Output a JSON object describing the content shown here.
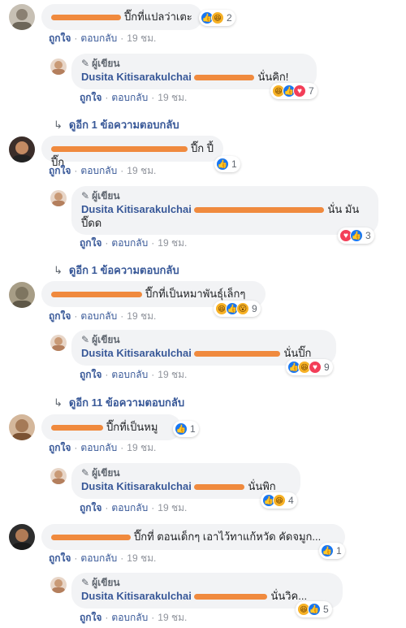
{
  "labels": {
    "like": "ถูกใจ",
    "reply": "ตอบกลับ",
    "author_tag": "ผู้เขียน"
  },
  "colors": {
    "link": "#385898",
    "bubble": "#f2f3f5",
    "redaction": "#f08a3e"
  },
  "author_name": "Dusita Kitisarakulchai",
  "threads": [
    {
      "comment": {
        "text": "ปี๊กที่แปลว่าเตะ",
        "time": "19 ชม.",
        "reaction_count": "2",
        "reactions": [
          "like-icon",
          "haha-icon"
        ]
      },
      "reply": {
        "text": "นั่นคิก!",
        "time": "19 ชม.",
        "reaction_count": "7",
        "reactions": [
          "haha-icon",
          "like-icon",
          "love-icon"
        ]
      },
      "more": null
    },
    {
      "comment": {
        "text": "ปี๊ก ปี้ ปี๊ก",
        "time": "19 ชม.",
        "reaction_count": "1",
        "reactions": [
          "like-icon"
        ]
      },
      "reply": {
        "text": "นั่น มันปี๊ดด",
        "time": "19 ชม.",
        "reaction_count": "3",
        "reactions": [
          "love-icon",
          "like-icon"
        ]
      },
      "more": "ดูอีก 1 ข้อความตอบกลับ"
    },
    {
      "comment": {
        "text": "ปี๊กที่เป็นหมาพันธุ์เล็กๆ",
        "time": "19 ชม.",
        "reaction_count": "9",
        "reactions": [
          "haha-icon",
          "like-icon",
          "wow-icon"
        ]
      },
      "reply": {
        "text": "นั่นปิ๊ก",
        "time": "19 ชม.",
        "reaction_count": "9",
        "reactions": [
          "like-icon",
          "haha-icon",
          "love-icon"
        ]
      },
      "more": "ดูอีก 11 ข้อความตอบกลับ"
    },
    {
      "comment": {
        "text": "ปี๊กที่เป็นหมู",
        "time": "19 ชม.",
        "reaction_count": "1",
        "reactions": [
          "like-icon"
        ]
      },
      "reply": {
        "text": "นั่นพิก",
        "time": "19 ชม.",
        "reaction_count": "4",
        "reactions": [
          "like-icon",
          "haha-icon"
        ]
      },
      "more": null
    },
    {
      "comment": {
        "text": "ปี๊กที่ ตอนเด็กๆ เอาไว้ทาแก้หวัด คัดจมูก...",
        "time": "19 ชม.",
        "reaction_count": "1",
        "reactions": [
          "like-icon"
        ]
      },
      "reply": {
        "text": "นั่นวิค...",
        "time": "19 ชม.",
        "reaction_count": "5",
        "reactions": [
          "haha-icon",
          "like-icon"
        ]
      },
      "more": null
    }
  ],
  "first_more": "ดูอีก 1 ข้อความตอบกลับ"
}
